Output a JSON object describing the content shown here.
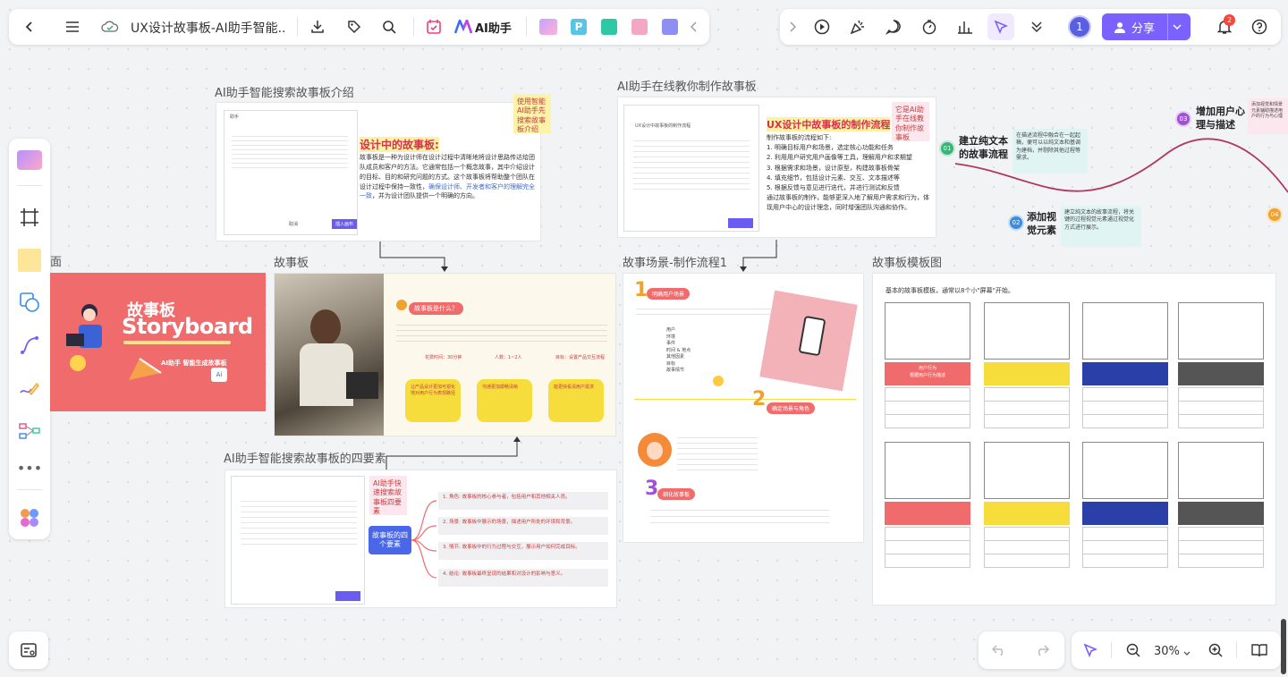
{
  "toolbar_left": {
    "title": "UX设计故事板-AI助手智能..",
    "ai_label": "AI助手"
  },
  "toolbar_right": {
    "avatar_initial": "1",
    "share_label": "分享",
    "notification_count": "2"
  },
  "frames": {
    "intro": "AI助手智能搜索故事板介绍",
    "online": "AI助手在线教你制作故事板",
    "storyboard": "故事板",
    "scene": "故事场景-制作流程1",
    "template": "故事板模板图",
    "four": "AI助手智能搜索故事板的四要素",
    "partial_left": "面"
  },
  "intro_card": {
    "heading": "设计中的故事板:",
    "body_pre": "故事板是一种为设计师在设计过程中清晰地将设计思路传达给团队成员和客户的方法。它通常包括一个概念故事，其中介绍设计的目标、目的和研究问题的方式。这个故事板将帮助整个团队在设计过程中保持一致性，",
    "body_link": "确保设计师、开发者和客户的理解完全一致",
    "body_post": "，并为设计团队提供一个明确的方向。",
    "sticky": "使用智能AI助手先搜索故事板介绍",
    "doc_label": "助手",
    "doc_btn1": "取消",
    "doc_btn2": "插入画布"
  },
  "online_card": {
    "heading": "UX设计中故事板的制作流程",
    "intro": "制作故事板的流程如下:",
    "steps": [
      "1. 明确目标用户和场景，选定核心功能和任务",
      "2. 利用用户研究用户画像等工具，理解用户和求期望",
      "3. 根据需求和场景，设计原型，构建故事板骨架",
      "4. 填充细节，包括设计元素、交互、文本描述等",
      "5. 根据反馈与意见进行迭代，并进行测试和反馈"
    ],
    "summary": "通过故事板的制作，能够更深入地了解用户需求和行为，体现用户中心的设计理念，同时增强团队沟通和协作。",
    "sticky": "它是AI助手在线教你制作故事板",
    "doc_title": "UX设计中故事板的制作流程"
  },
  "flow": {
    "step1_num": "01",
    "step1_title": "建立纯文本的故事流程",
    "step2_num": "02",
    "step2_title": "添加视觉元素",
    "step3_num": "03",
    "step3_title": "增加用户心理与描述",
    "step4_num": "04",
    "note1": "在描述流程中融合在一起起稿，便可以以纯文本和基调为建档，并剔除其他过程等需求。",
    "note2": "建立纯文本的故事流程，将关键的过程视觉元素通过视觉化方式进行展示。",
    "note3": "添加视觉和情景元素辅助描述用户的行为与心理"
  },
  "storyboard_card": {
    "logo_cn": "故事板",
    "logo_en": "Storyboard",
    "logo_sub": "AI助手 智能生成故事板",
    "q_title": "故事板是什么？",
    "stat1": "花费时间：30分钟",
    "stat2": "人数：1~2人",
    "stat3": "目标：设置产品交互流程",
    "box1": "让产品设计更加可视化地对用户行为表现路径",
    "box2": "沟通更加顺畅清晰",
    "box3": "能更快看清用户需求"
  },
  "scene_card": {
    "tag1": "明确用户场景",
    "tag2": "确定场景与角色",
    "tag3": "细化故事板",
    "list": [
      "用户",
      "环境",
      "事件",
      "时间 & 地点",
      "其他因素",
      "目标",
      "故事情节"
    ]
  },
  "template_card": {
    "desc": "基本的故事板模板，通常以8个小\"屏幕\"开始。",
    "label": "用户行为",
    "sub": "根据用户行为描述"
  },
  "four_card": {
    "center": "故事板的四个要素",
    "sticky": "AI助手快速搜索故事板四要素",
    "items": [
      "1. 角色: 故事板的核心参与者，包括用户和其他相关人员。",
      "2. 场景: 故事板中展示的场景，描述用户所处的环境和背景。",
      "3. 情节: 故事板中的行为过程与交互，展示用户如何完成目标。",
      "4. 结论: 故事板最终呈现的结果和对设计的影响与意义。"
    ]
  },
  "zoom": {
    "level": "30%"
  },
  "colors": {
    "accent": "#7c5cff",
    "share_bg": "#7b61ff",
    "badge": "#f5473b",
    "pink": "#f06c6c",
    "yellow": "#f6dd3c"
  }
}
